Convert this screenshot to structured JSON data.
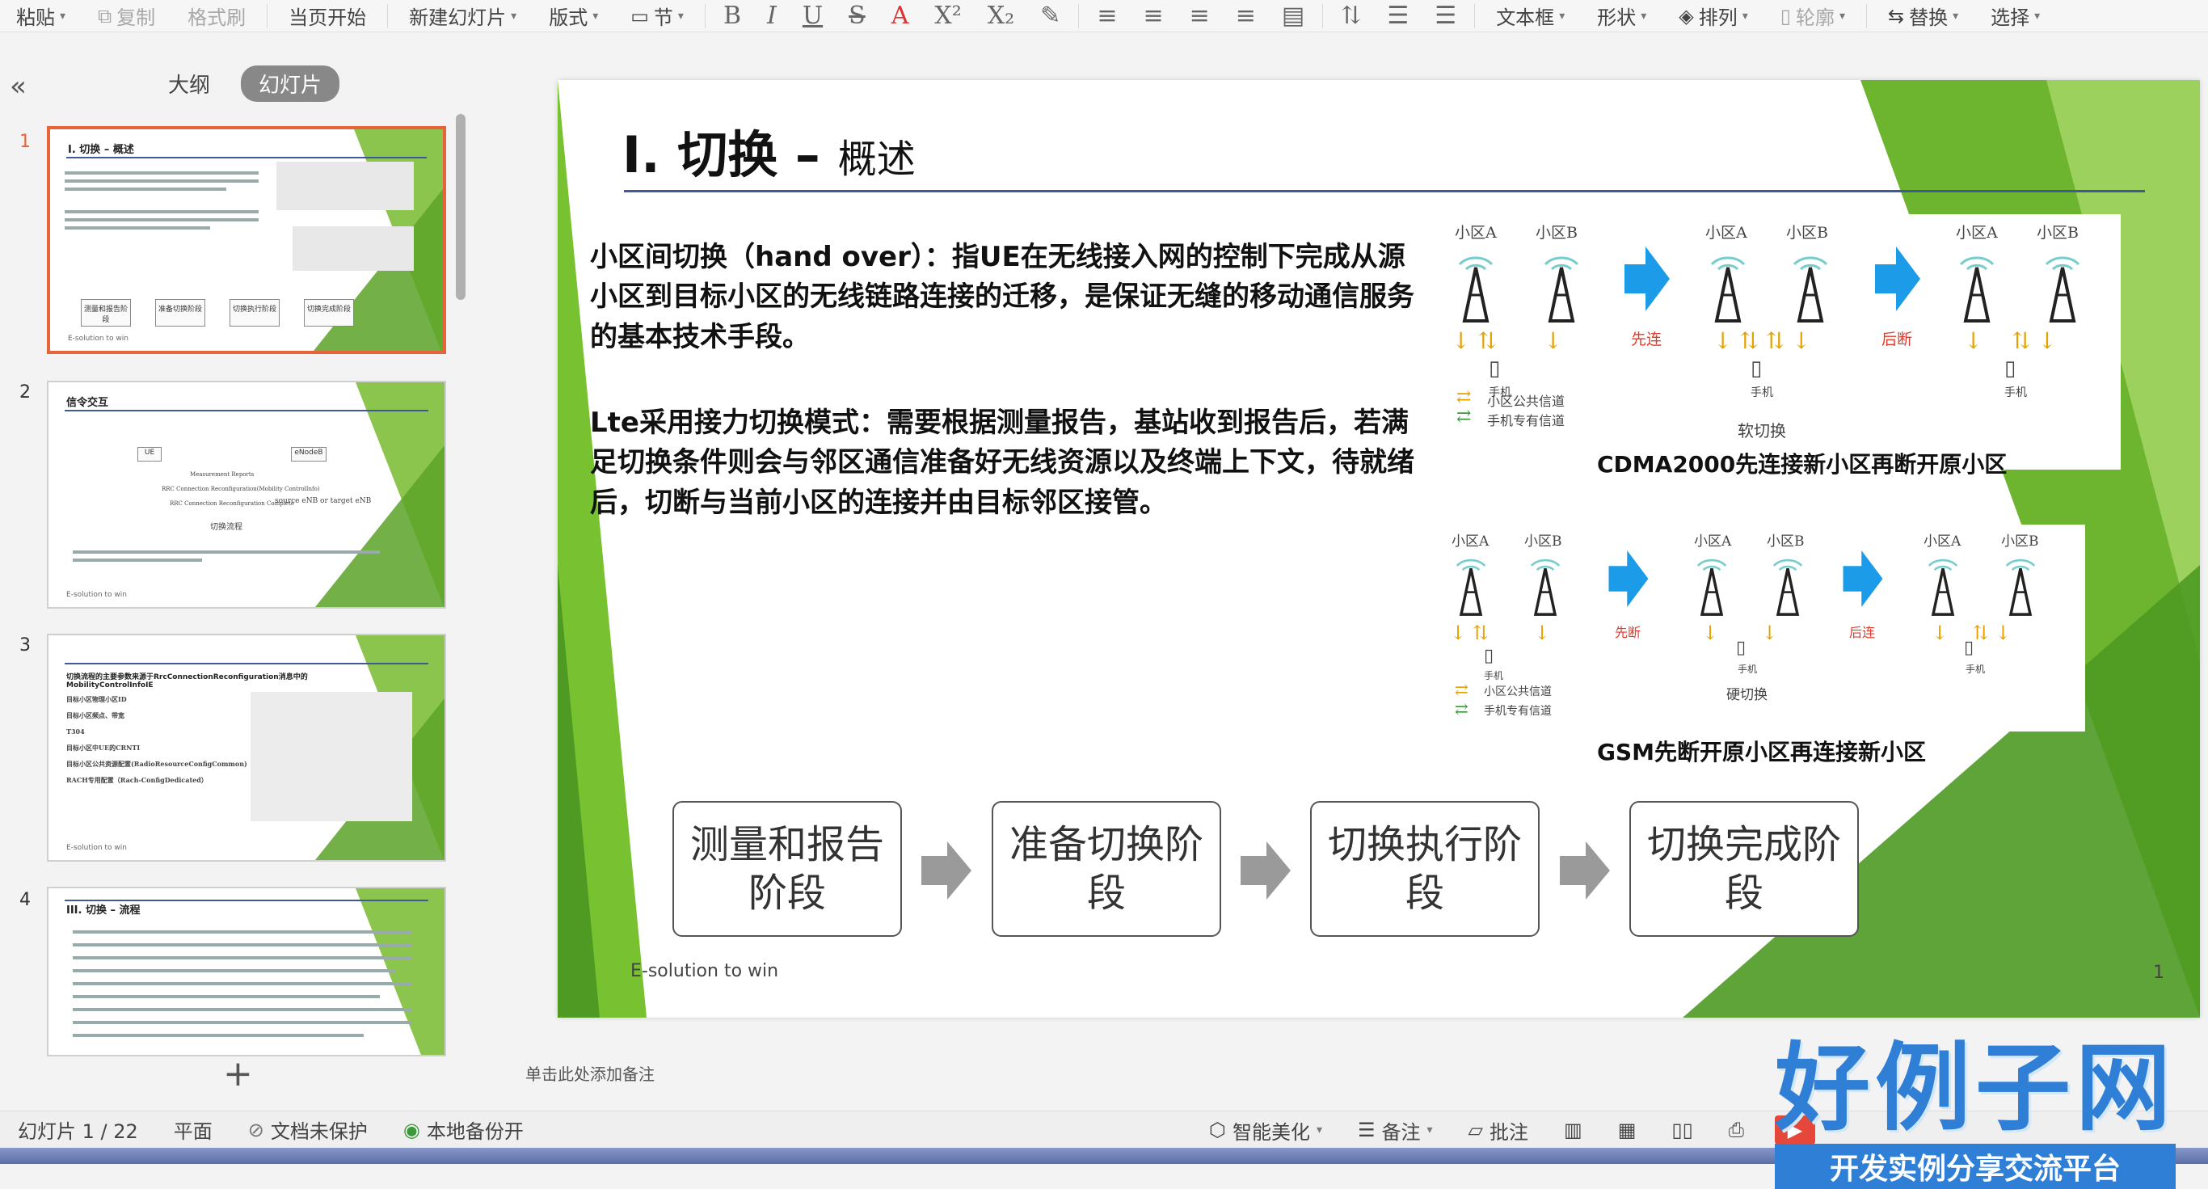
{
  "toolbar": {
    "items": [
      "粘贴",
      "复制",
      "格式刷",
      "当页开始",
      "新建幻灯片",
      "版式",
      "节",
      "文本框",
      "形状",
      "排列",
      "轮廓",
      "替换",
      "选择"
    ]
  },
  "left_panel": {
    "tabs": [
      "大纲",
      "幻灯片"
    ],
    "active_tab": "幻灯片",
    "thumbs": [
      {
        "num": "1",
        "title": "I. 切换 – 概述",
        "phases": [
          "测量和报告阶段",
          "准备切换阶段",
          "切换执行阶段",
          "切换完成阶段"
        ],
        "footer": "E-solution to win"
      },
      {
        "num": "2",
        "title": "信令交互",
        "labels": [
          "UE",
          "eNodeB",
          "Measurement Reports",
          "RRC Connection Reconfiguration(Mobility ControlInfo)",
          "RRC Connection Reconfiguration Complete",
          "source eNB or target eNB",
          "切换流程"
        ],
        "footer": "E-solution to win"
      },
      {
        "num": "3",
        "title": "切换流程的主要参数来源于RrcConnectionReconfiguration消息中的MobilityControlInfoIE",
        "bullets": [
          "目标小区物理小区ID",
          "目标小区频点、带宽",
          "T304",
          "目标小区中UE的CRNTI",
          "目标小区公共资源配置(RadioResourceConfigCommon)",
          "RACH专用配置（Rach-ConfigDedicated）"
        ],
        "footer": "E-solution to win"
      },
      {
        "num": "4",
        "title": "III. 切换 – 流程"
      }
    ]
  },
  "slide": {
    "title": "I. 切换 –",
    "subtitle": "概述",
    "para1": "小区间切换（hand over）：指UE在无线接入网的控制下完成从源小区到目标小区的无线链路连接的迁移，是保证无缝的移动通信服务的基本技术手段。",
    "para2": "Lte采用接力切换模式：需要根据测量报告，基站收到报告后，若满足切换条件则会与邻区通信准备好无线资源以及终端上下文，待就绪后，切断与当前小区的连接并由目标邻区接管。",
    "cell_a": "小区A",
    "cell_b": "小区B",
    "phone": "手机",
    "first_connect": "先连",
    "then_break": "后断",
    "first_break": "先断",
    "then_connect": "后连",
    "legend_common": "小区公共信道",
    "legend_dedicated": "手机专有信道",
    "soft_handover": "软切换",
    "hard_handover": "硬切换",
    "caption_cdma": "CDMA2000先连接新小区再断开原小区",
    "caption_gsm": "GSM先断开原小区再连接新小区",
    "phases": [
      "测量和报告阶段",
      "准备切换阶段",
      "切换执行阶段",
      "切换完成阶段"
    ],
    "footer": "E-solution to win",
    "page_number": "1"
  },
  "notes_placeholder": "单击此处添加备注",
  "status": {
    "slide_counter": "幻灯片 1 / 22",
    "theme": "平面",
    "protect": "文档未保护",
    "backup": "本地备份开",
    "beautify": "智能美化",
    "notes": "备注",
    "comments": "批注"
  },
  "watermark": {
    "main": "好例子网",
    "sub": "开发实例分享交流平台"
  },
  "colors": {
    "accent_orange": "#e8623a",
    "title_line": "#3e5a98",
    "green": "#6db42f",
    "arrow_blue": "#1c9be8",
    "play_red": "#e6473b",
    "watermark_blue": "#2f7fd6"
  }
}
